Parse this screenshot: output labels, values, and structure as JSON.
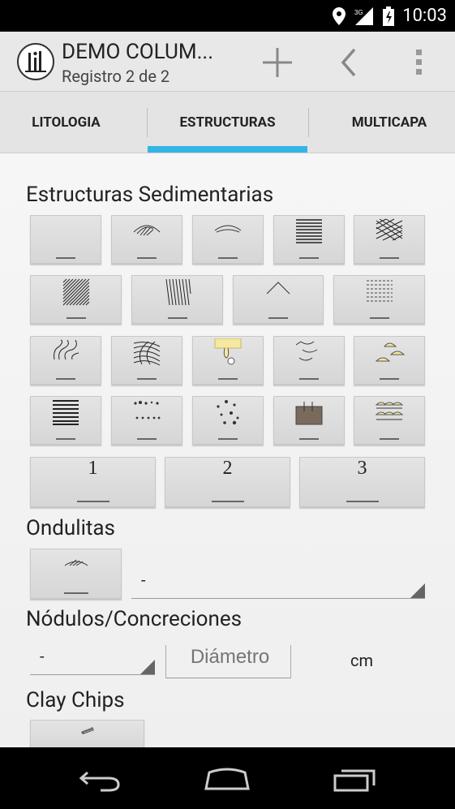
{
  "status_bar": {
    "network": "3G",
    "time": "10:03"
  },
  "action_bar": {
    "title": "DEMO COLUM...",
    "subtitle": "Registro 2 de 2",
    "icons": [
      "add-icon",
      "back-chevron-icon",
      "overflow-menu-icon"
    ]
  },
  "tabs": [
    {
      "label": "LITOLOGIA"
    },
    {
      "label": "ESTRUCTURAS",
      "selected": true
    },
    {
      "label": "MULTICAPA"
    }
  ],
  "accent_color": "#33b5e5",
  "sections": {
    "estructuras": {
      "title": "Estructuras Sedimentarias",
      "buttons": [
        "blank",
        "arc-laminae",
        "lens-laminae",
        "horizontal-lamination",
        "cross-hatched",
        "diagonal-lamination",
        "steep-lamination",
        "chevron",
        "dashed-lamination",
        "convolute",
        "curved-lamination",
        "yellow-drip",
        "smile-lines",
        "yellow-lenses",
        "thick-lamination",
        "scattered-dots",
        "random-dots",
        "brown-block",
        "yellow-lens-stack"
      ],
      "number_buttons": [
        "1",
        "2",
        "3"
      ]
    },
    "ondulitas": {
      "title": "Ondulitas",
      "button_icon": "ripple-icon",
      "spinner_value": "-"
    },
    "nodulos": {
      "title": "Nódulos/Concreciones",
      "spinner_value": "-",
      "diameter_placeholder": "Diámetro",
      "unit": "cm"
    },
    "clay_chips": {
      "title": "Clay Chips",
      "button_icon": "clay-chip-icon"
    }
  },
  "nav_bar": {
    "icons": [
      "back-nav-icon",
      "home-nav-icon",
      "recents-nav-icon"
    ]
  }
}
